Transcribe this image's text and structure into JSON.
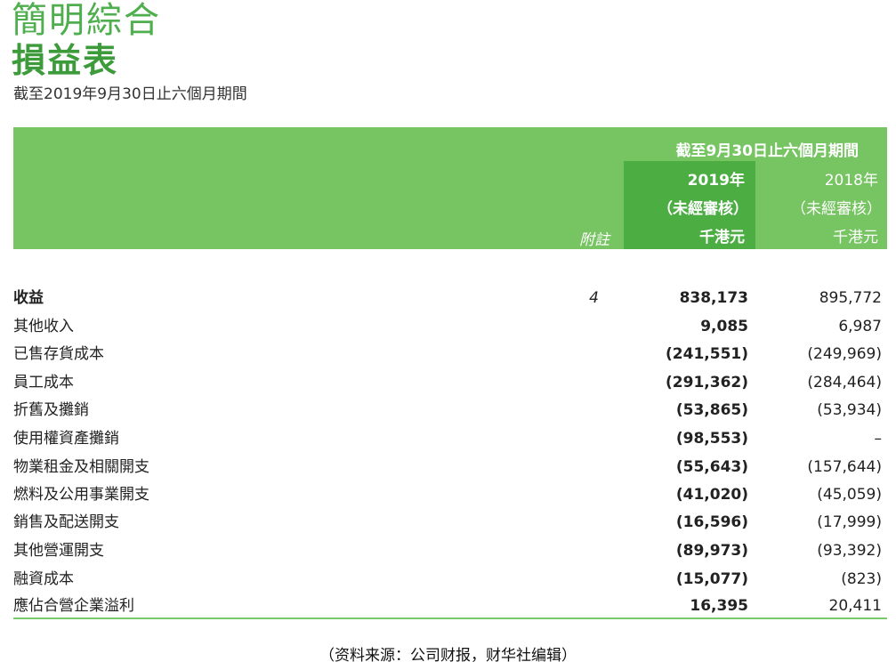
{
  "header": {
    "title_line1": "簡明綜合",
    "title_line2": "損益表",
    "subtitle": "截至2019年9月30日止六個月期間"
  },
  "table_head": {
    "period": "截至9月30日止六個月期間",
    "note_label": "附註",
    "col_2019": {
      "year": "2019年",
      "status": "（未經審核）",
      "unit": "千港元"
    },
    "col_2018": {
      "year": "2018年",
      "status": "（未經審核）",
      "unit": "千港元"
    }
  },
  "rows": [
    {
      "label": "收益",
      "note": "4",
      "v2019": "838,173",
      "v2018": "895,772"
    },
    {
      "label": "其他收入",
      "note": "",
      "v2019": "9,085",
      "v2018": "6,987"
    },
    {
      "label": "已售存貨成本",
      "note": "",
      "v2019": "(241,551)",
      "v2018": "(249,969)"
    },
    {
      "label": "員工成本",
      "note": "",
      "v2019": "(291,362)",
      "v2018": "(284,464)"
    },
    {
      "label": "折舊及攤銷",
      "note": "",
      "v2019": "(53,865)",
      "v2018": "(53,934)"
    },
    {
      "label": "使用權資產攤銷",
      "note": "",
      "v2019": "(98,553)",
      "v2018": "–"
    },
    {
      "label": "物業租金及相關開支",
      "note": "",
      "v2019": "(55,643)",
      "v2018": "(157,644)"
    },
    {
      "label": "燃料及公用事業開支",
      "note": "",
      "v2019": "(41,020)",
      "v2018": "(45,059)"
    },
    {
      "label": "銷售及配送開支",
      "note": "",
      "v2019": "(16,596)",
      "v2018": "(17,999)"
    },
    {
      "label": "其他營運開支",
      "note": "",
      "v2019": "(89,973)",
      "v2018": "(93,392)"
    },
    {
      "label": "融資成本",
      "note": "",
      "v2019": "(15,077)",
      "v2018": "(823)"
    },
    {
      "label": "應佔合營企業溢利",
      "note": "",
      "v2019": "16,395",
      "v2018": "20,411"
    }
  ],
  "source": "（资料来源：公司财报，财华社编辑）",
  "colors": {
    "header_green": "#76c462",
    "highlight_green": "#4cad43",
    "title_green": "#4fae4e"
  }
}
